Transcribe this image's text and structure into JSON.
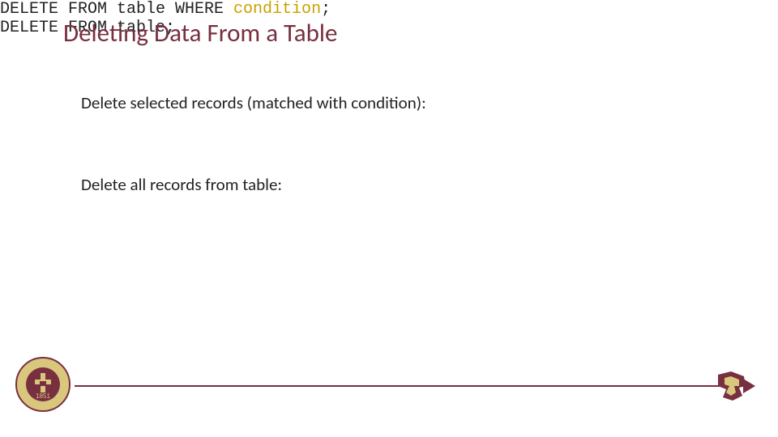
{
  "title": "Deleting Data From a Table",
  "body": {
    "line1": "Delete selected records (matched with condition):",
    "code1a": "DELETE FROM table WHERE ",
    "code1b": "condition",
    "code1c": ";",
    "line2": "Delete all records from table:",
    "code2": "DELETE FROM table;"
  },
  "seal": {
    "year": "1851"
  },
  "colors": {
    "accent": "#782F40",
    "gold": "#caa000"
  }
}
